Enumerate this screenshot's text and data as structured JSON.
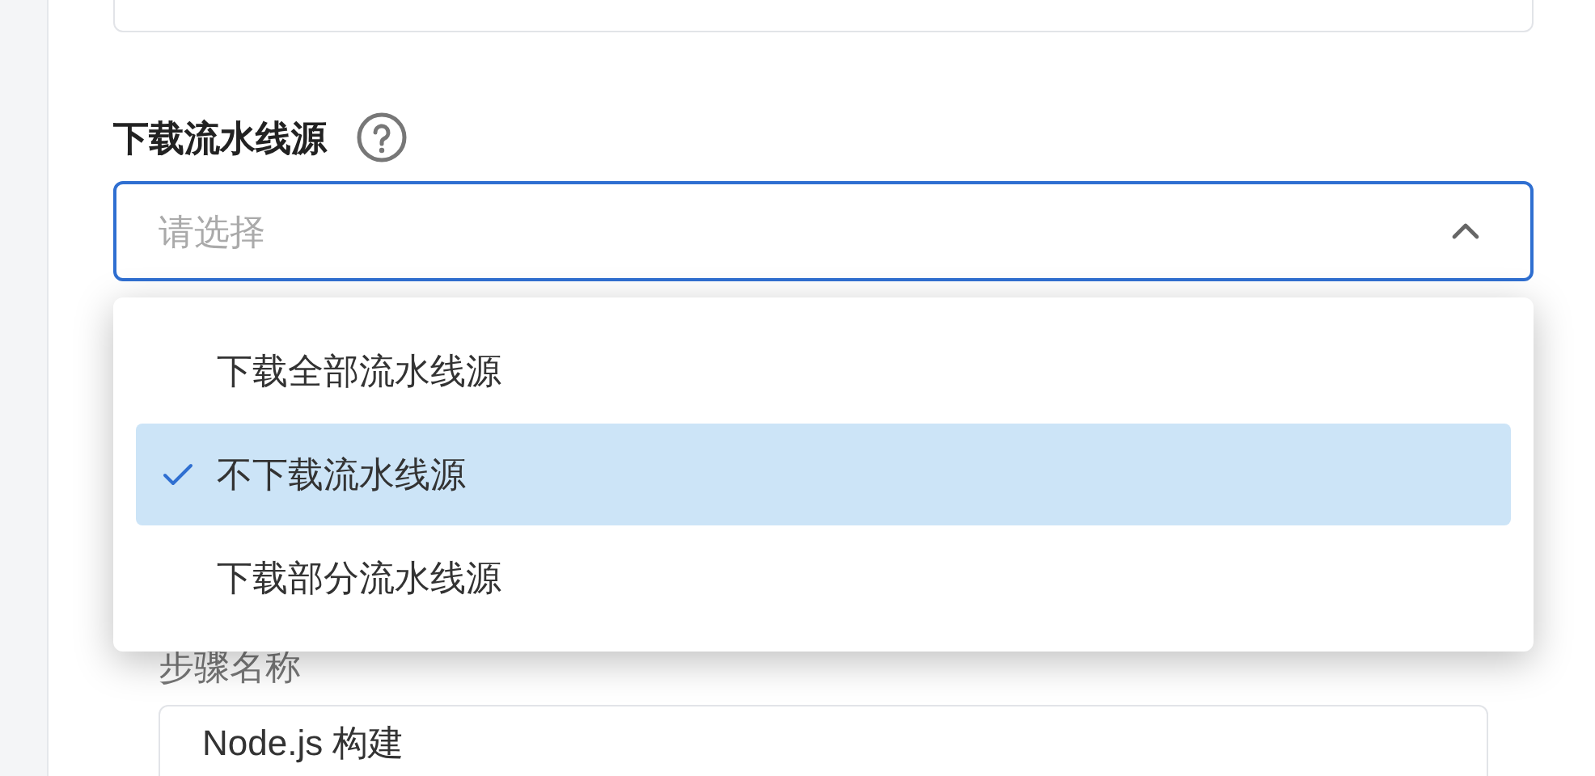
{
  "field": {
    "label": "下载流水线源",
    "placeholder": "请选择",
    "expanded": true
  },
  "options": [
    {
      "label": "下载全部流水线源",
      "selected": false
    },
    {
      "label": "不下载流水线源",
      "selected": true
    },
    {
      "label": "下载部分流水线源",
      "selected": false
    }
  ],
  "step": {
    "label": "步骤名称",
    "value": "Node.js 构建"
  }
}
